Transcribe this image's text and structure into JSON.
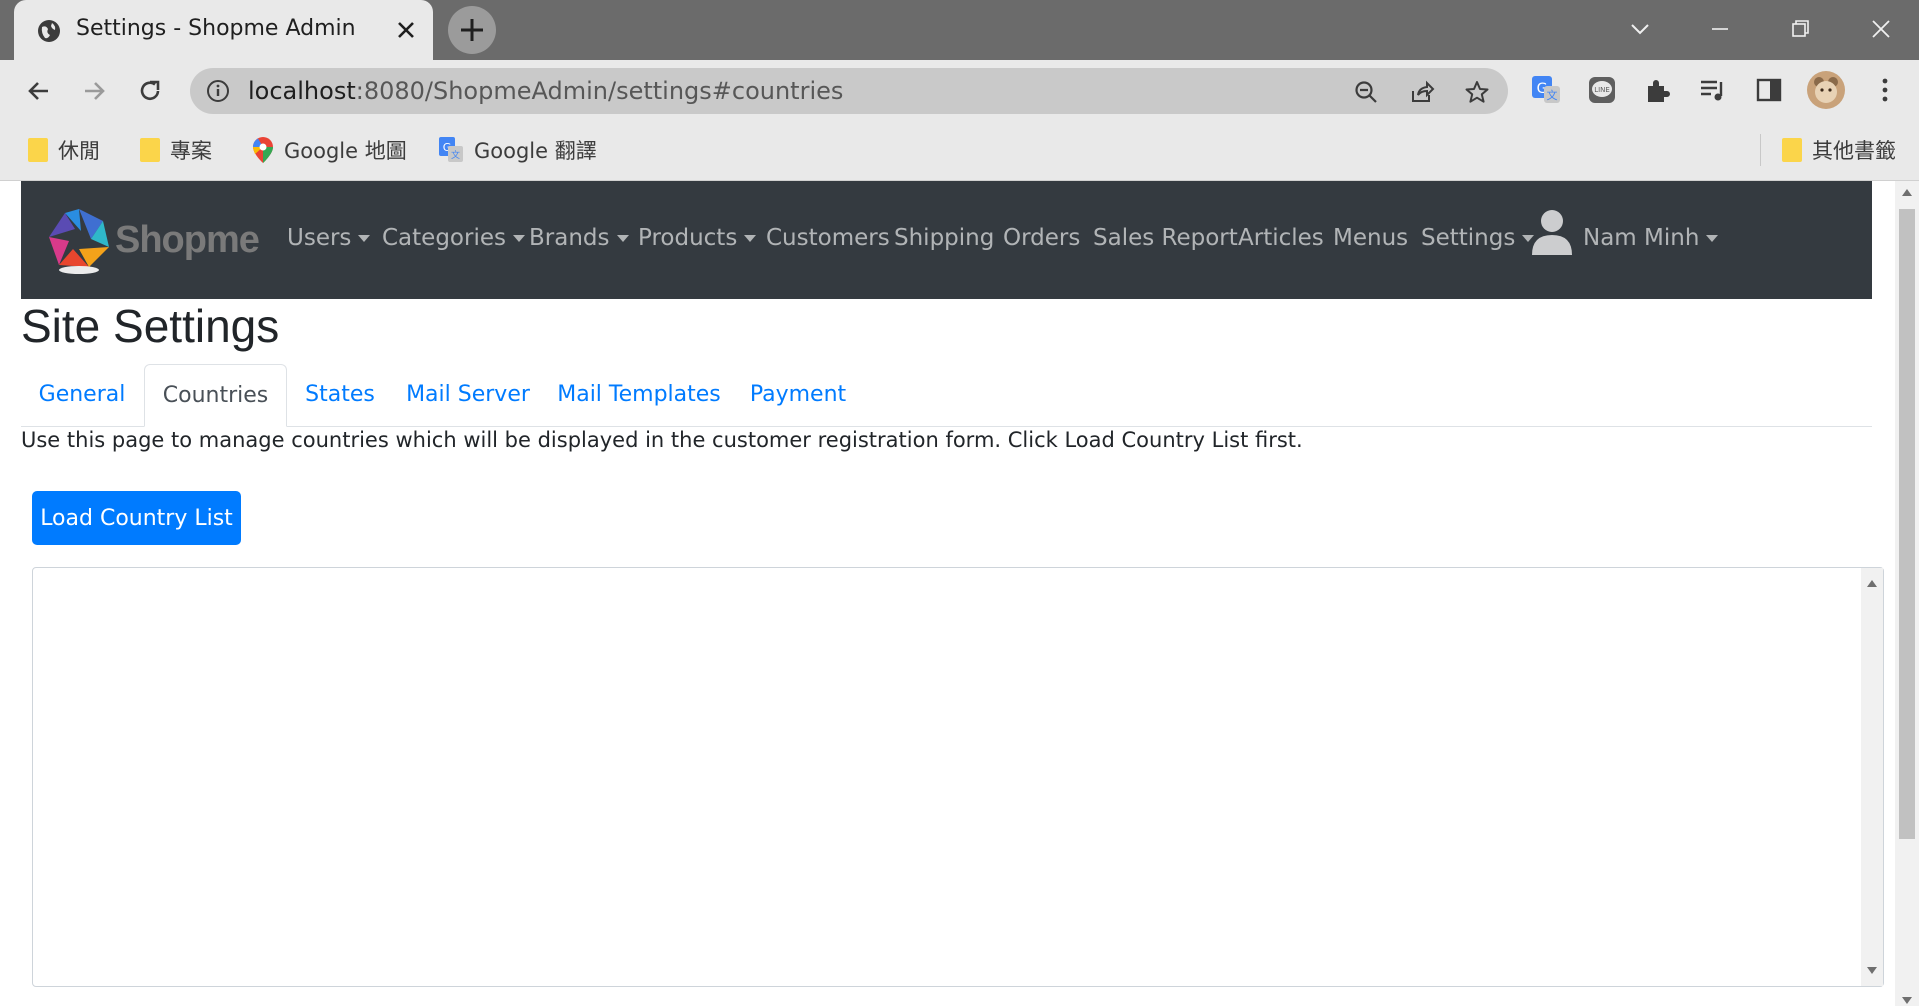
{
  "browser": {
    "tab_title": "Settings - Shopme Admin",
    "url_host": "localhost",
    "url_rest": ":8080/ShopmeAdmin/settings#countries",
    "bookmarks": [
      {
        "label": "休閒",
        "icon": "folder-icon"
      },
      {
        "label": "專案",
        "icon": "folder-icon"
      },
      {
        "label": "Google 地圖",
        "icon": "google-maps-icon"
      },
      {
        "label": "Google 翻譯",
        "icon": "google-translate-icon"
      }
    ],
    "other_bookmarks": "其他書籤"
  },
  "navbar": {
    "logo_text": "Shopme",
    "items": [
      {
        "label": "Users",
        "dropdown": true
      },
      {
        "label": "Categories",
        "dropdown": true
      },
      {
        "label": "Brands",
        "dropdown": true
      },
      {
        "label": "Products",
        "dropdown": true
      },
      {
        "label": "Customers",
        "dropdown": false
      },
      {
        "label": "Shipping",
        "dropdown": false
      },
      {
        "label": "Orders",
        "dropdown": false
      },
      {
        "label": "Sales Report",
        "dropdown": false
      },
      {
        "label": "Articles",
        "dropdown": false
      },
      {
        "label": "Menus",
        "dropdown": false
      },
      {
        "label": "Settings",
        "dropdown": true
      }
    ],
    "user_name": "Nam Minh"
  },
  "page": {
    "title": "Site Settings",
    "tabs": [
      "General",
      "Countries",
      "States",
      "Mail Server",
      "Mail Templates",
      "Payment"
    ],
    "active_tab": "Countries",
    "description": "Use this page to manage countries which will be displayed in the customer registration form. Click Load Country List first.",
    "load_button": "Load Country List"
  },
  "colors": {
    "navbar_bg": "#343a40",
    "primary": "#007bff",
    "tabstrip": "#6b6b6b"
  }
}
